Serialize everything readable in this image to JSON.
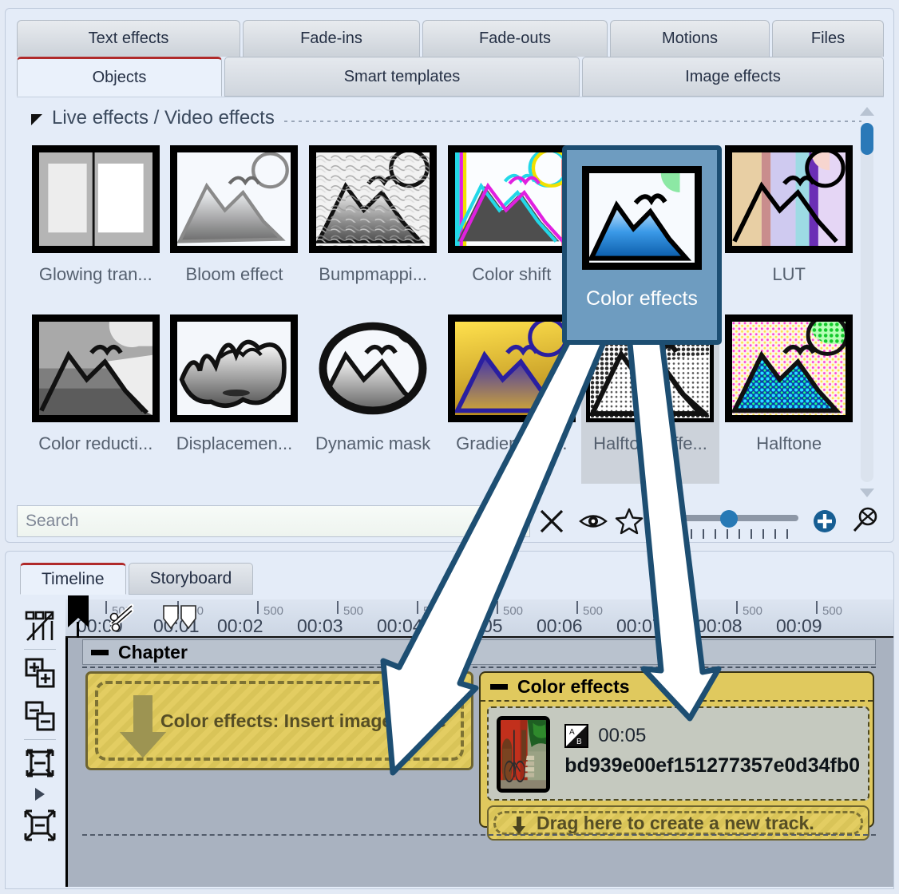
{
  "top_panel": {
    "tabs_row1": [
      {
        "label": "Text effects"
      },
      {
        "label": "Fade-ins"
      },
      {
        "label": "Fade-outs"
      },
      {
        "label": "Motions"
      },
      {
        "label": "Files"
      }
    ],
    "tabs_row2": [
      {
        "label": "Objects",
        "active": true
      },
      {
        "label": "Smart templates",
        "active": false
      },
      {
        "label": "Image effects",
        "active": false
      }
    ],
    "section": {
      "title": "Live effects / Video effects",
      "collapse_icon": "triangle-collapse-icon"
    },
    "effects": [
      {
        "label": "Glowing tran...",
        "art": "split-frame"
      },
      {
        "label": "Bloom effect",
        "art": "bloom"
      },
      {
        "label": "Bumpmappi...",
        "art": "bump"
      },
      {
        "label": "Color shift",
        "art": "colorshift"
      },
      {
        "label": "Color effects",
        "art": "coloreffects",
        "selected": true
      },
      {
        "label": "LUT",
        "art": "lut"
      },
      {
        "label": "Color reducti...",
        "art": "colorreduce"
      },
      {
        "label": "Displacemen...",
        "art": "displacement"
      },
      {
        "label": "Dynamic mask",
        "art": "dynamicmask"
      },
      {
        "label": "Gradient Ma...",
        "art": "gradientmap"
      },
      {
        "label": "Halftone effe...",
        "art": "halftonegray",
        "hover": true
      },
      {
        "label": "Halftone",
        "art": "halftonecolor"
      }
    ],
    "search": {
      "placeholder": "Search",
      "value": "",
      "clear_icon": "close-x-icon",
      "preview_icon": "eye-icon",
      "favorite_icon": "star-icon"
    },
    "zoom": {
      "slider_value": 35,
      "add_icon": "plus-circle-icon",
      "reset_icon": "zoom-reset-icon"
    },
    "scrollbar": {
      "up_icon": "scroll-up-icon",
      "down_icon": "scroll-down-icon",
      "thumb_position_pct": 2
    }
  },
  "callout": {
    "label": "Color effects",
    "border_color": "#1d4e72",
    "fill_color": "#6e9cc0",
    "arrow_count": 2
  },
  "timeline": {
    "tabs": [
      {
        "label": "Timeline",
        "active": true
      },
      {
        "label": "Storyboard",
        "active": false
      }
    ],
    "tools": [
      {
        "name": "object-mode-icon"
      },
      {
        "name": "add-objects-icon"
      },
      {
        "name": "remove-objects-icon"
      },
      {
        "name": "fit-height-icon"
      },
      {
        "name": "expand-caret-icon"
      },
      {
        "name": "fit-all-icon"
      }
    ],
    "ruler": {
      "labels": [
        "00:00",
        "00:01",
        "00:02",
        "00:03",
        "00:04",
        "00:05",
        "00:06",
        "00:07",
        "00:08",
        "00:09"
      ],
      "subtick_label": "500",
      "playhead_position": "00:00"
    },
    "chapter": {
      "label": "Chapter",
      "collapse_icon": "minus-icon"
    },
    "dropzone": {
      "text": "Color effects: Insert images here",
      "arrow_icon": "down-arrow-icon"
    },
    "effect_track": {
      "title": "Color effects",
      "collapse_icon": "minus-icon",
      "clip": {
        "duration": "00:05",
        "name": "bd939e00ef151277357e0d34fb0",
        "transition_icon": "ab-transition-icon",
        "thumbnail": "red-building-bicycle-stairs"
      },
      "new_track_hint": {
        "text": "Drag here to create a new track.",
        "arrow_icon": "down-arrow-icon"
      }
    }
  }
}
